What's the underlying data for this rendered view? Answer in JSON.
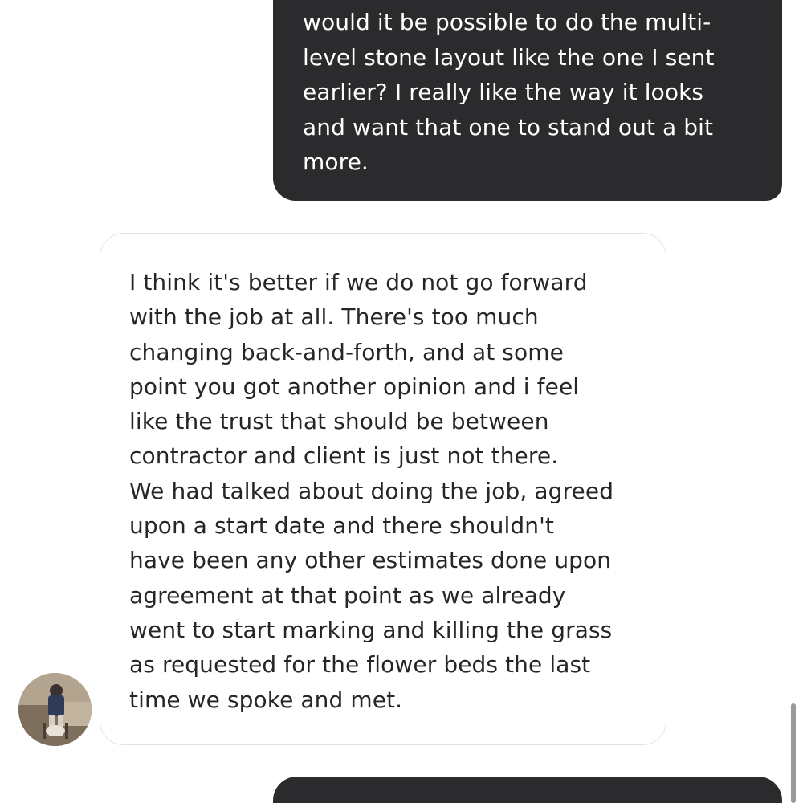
{
  "conversation": {
    "messages": [
      {
        "direction": "outgoing",
        "text": "would it be possible to do the multi-\nlevel stone layout like the one I sent\nearlier? I really like the way it looks\nand want that one to stand out a bit\nmore."
      },
      {
        "direction": "incoming",
        "text": "I think it's better if we do not go forward\nwith the job at all. There's too much\nchanging back-and-forth, and at some\npoint you got another opinion and i feel\nlike the trust that should be between\ncontractor and client is just not there.\nWe had talked about doing the job, agreed\nupon a start date and there shouldn't\nhave been any other estimates done upon\nagreement at that point as we already\nwent to start marking and killing the grass\nas requested for the flower beds the last\ntime we spoke and met."
      },
      {
        "direction": "outgoing",
        "text": ""
      }
    ]
  },
  "colors": {
    "outgoing_bubble": "#2b2b2d",
    "incoming_bubble_border": "#e3e3e3",
    "incoming_text": "#262626",
    "outgoing_text": "#ffffff"
  },
  "icons": {
    "avatar": "contact-avatar-photo",
    "scrollbar": "scrollbar-thumb"
  }
}
